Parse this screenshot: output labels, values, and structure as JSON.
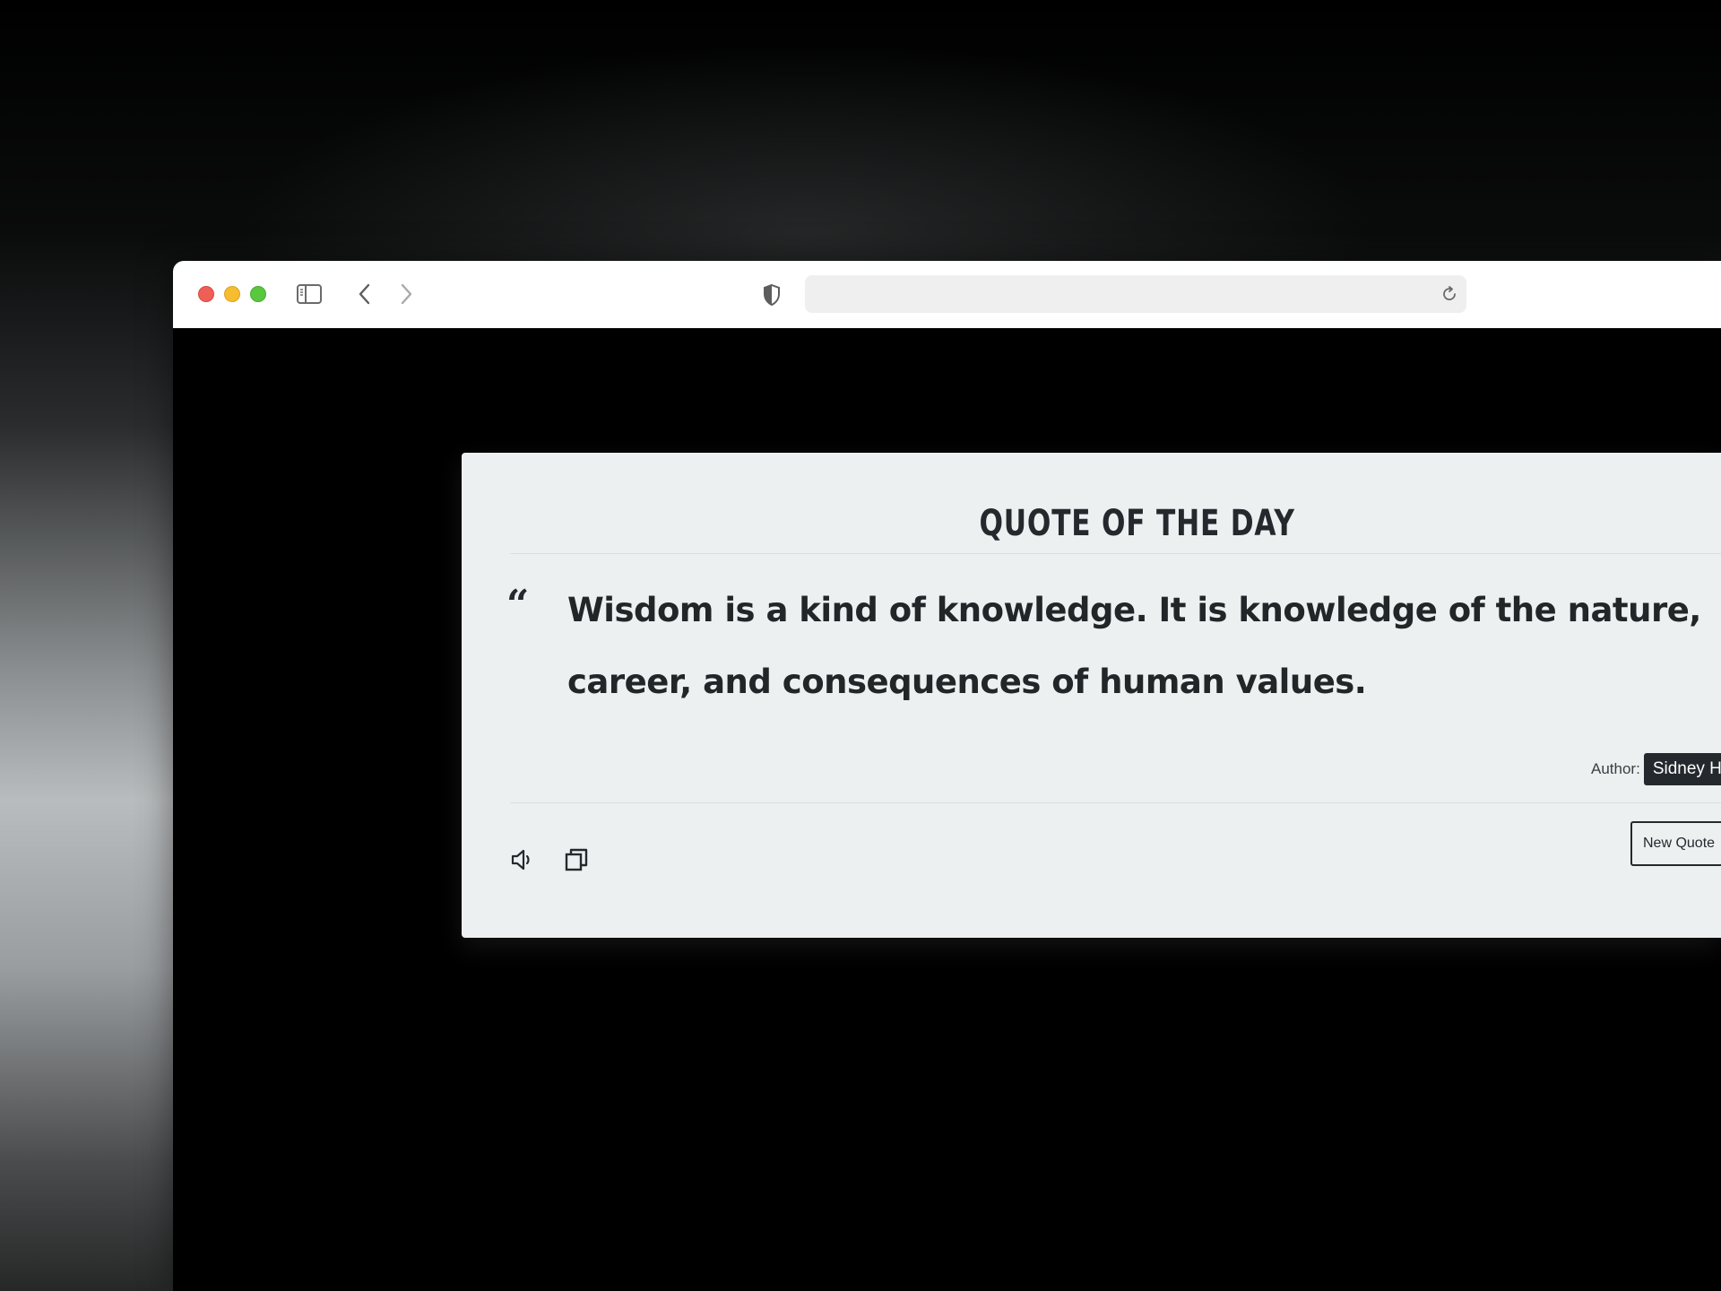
{
  "browser": {
    "address_text": "",
    "traffic_light_colors": {
      "close": "#ee5f57",
      "minimize": "#f5bd2f",
      "maximize": "#5ac73f"
    },
    "icons": [
      "sidebar-toggle-icon",
      "back-chevron-icon",
      "forward-chevron-icon",
      "shield-icon",
      "reload-icon"
    ]
  },
  "card": {
    "title": "QUOTE OF THE DAY",
    "quote_mark": "“",
    "quote_text": "Wisdom is a kind of knowledge. It is knowledge of the nature, career, and consequences of human values.",
    "author_label": "Author:",
    "author_name": "Sidney Hook",
    "new_quote_label": "New Quote",
    "icons": [
      "speaker-icon",
      "copy-icon"
    ]
  },
  "colors": {
    "page_background": "#000000",
    "card_background": "#ecf0f1",
    "text": "#24292e",
    "author_badge": "#24292e"
  }
}
